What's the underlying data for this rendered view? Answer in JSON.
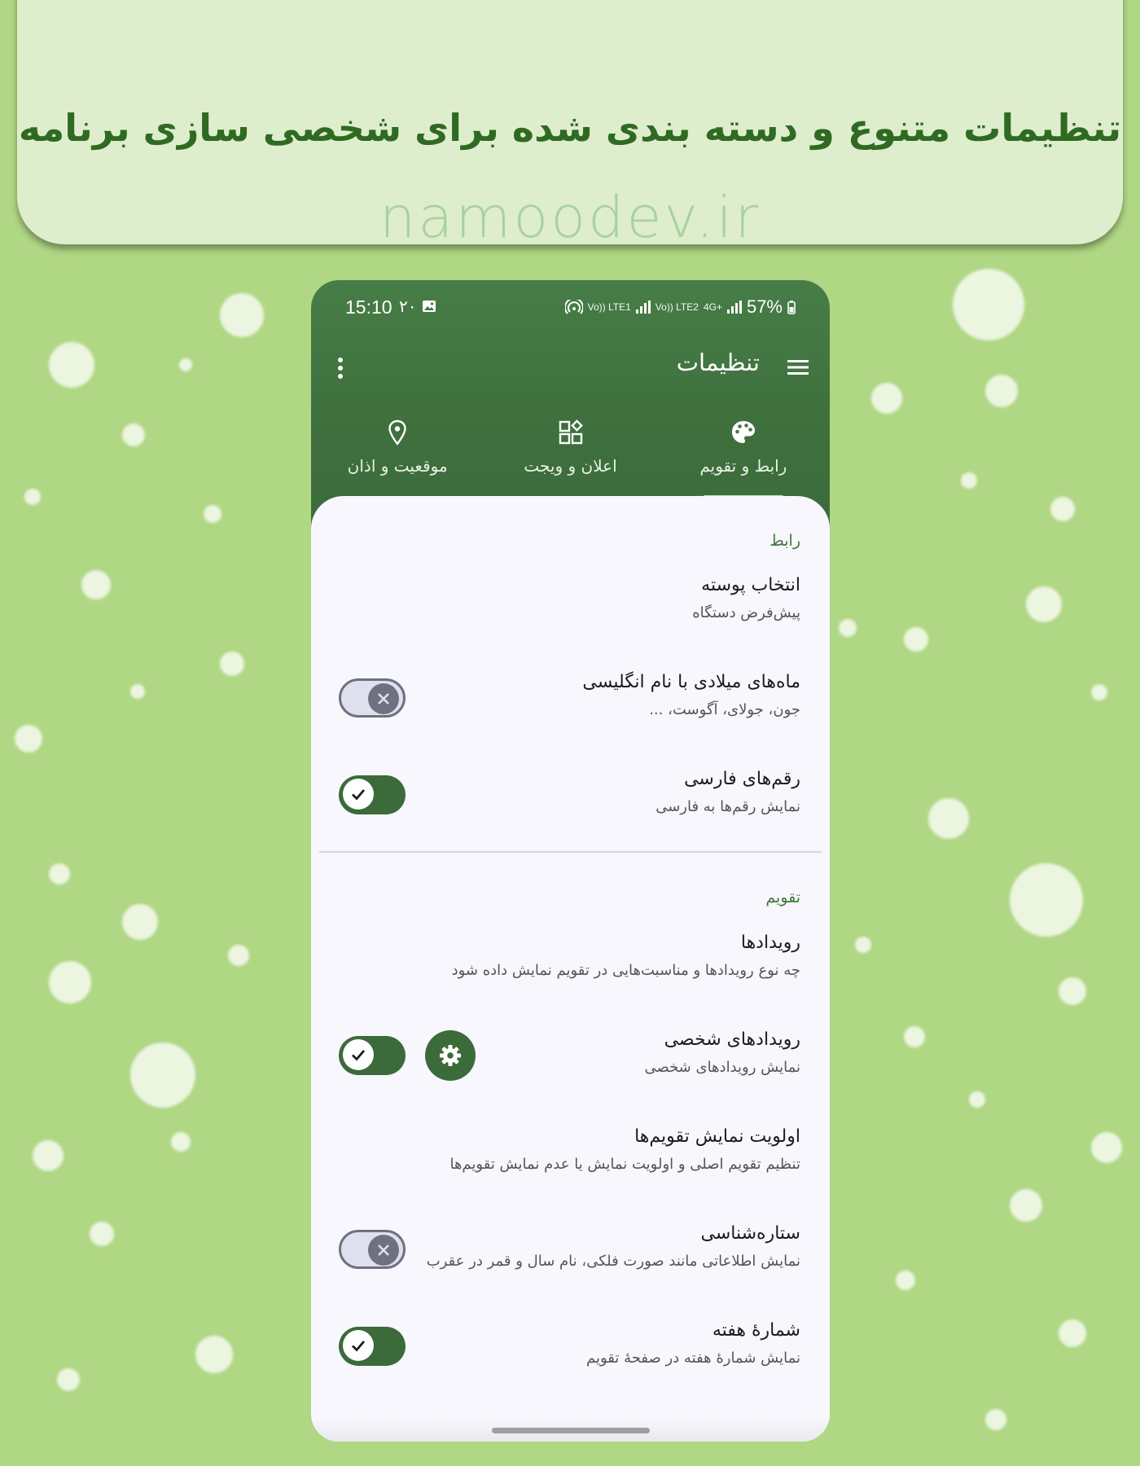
{
  "banner": {
    "headline": "تنظیمات متنوع و دسته بندی شده برای شخصی سازی برنامه",
    "website": "namoodev.ir"
  },
  "status_bar": {
    "time": "15:10",
    "extra": "۲۰",
    "sim1_label": "Vo)) LTE1",
    "sim2_label": "Vo)) LTE2",
    "network": "4G+",
    "battery": "57%"
  },
  "app_bar": {
    "title": "تنظیمات",
    "menu_icon": "hamburger-icon",
    "overflow_icon": "more-vert-icon"
  },
  "tabs": [
    {
      "label": "رابط و تقویم",
      "icon": "palette-icon",
      "active": true
    },
    {
      "label": "اعلان و ویجت",
      "icon": "widgets-icon",
      "active": false
    },
    {
      "label": "موقعیت و اذان",
      "icon": "location-pin-icon",
      "active": false
    }
  ],
  "sections": [
    {
      "header": "رابط",
      "items": [
        {
          "title": "انتخاب پوسته",
          "subtitle": "پیش‌فرض دستگاه",
          "control": "none"
        },
        {
          "title": "ماه‌های میلادی با نام انگلیسی",
          "subtitle": "جون، جولای، آگوست، ...",
          "control": "switch",
          "checked": false
        },
        {
          "title": "رقم‌های فارسی",
          "subtitle": "نمایش رقم‌ها به فارسی",
          "control": "switch",
          "checked": true
        }
      ]
    },
    {
      "header": "تقویم",
      "items": [
        {
          "title": "رویدادها",
          "subtitle": "چه نوع رویدادها و مناسبت‌هایی در تقویم نمایش داده شود",
          "control": "none"
        },
        {
          "title": "رویدادهای شخصی",
          "subtitle": "نمایش رویدادهای شخصی",
          "control": "switch",
          "checked": true,
          "extra_button": "gear-icon"
        },
        {
          "title": "اولویت نمایش تقویم‌ها",
          "subtitle": "تنظیم تقویم اصلی و اولویت نمایش یا عدم نمایش تقویم‌ها",
          "control": "none"
        },
        {
          "title": "ستاره‌شناسی",
          "subtitle": "نمایش اطلاعاتی مانند صورت فلکی، نام سال و قمر در عقرب",
          "control": "switch",
          "checked": false
        },
        {
          "title": "شمارهٔ هفته",
          "subtitle": "نمایش شمارهٔ هفته در صفحهٔ تقویم",
          "control": "switch",
          "checked": true
        }
      ]
    }
  ],
  "colors": {
    "background": "#b0d784",
    "banner": "#deedcc",
    "headline": "#2f6a23",
    "appbar": "#437743",
    "accent": "#3b6b3a",
    "switch_off": "#6f7080"
  }
}
